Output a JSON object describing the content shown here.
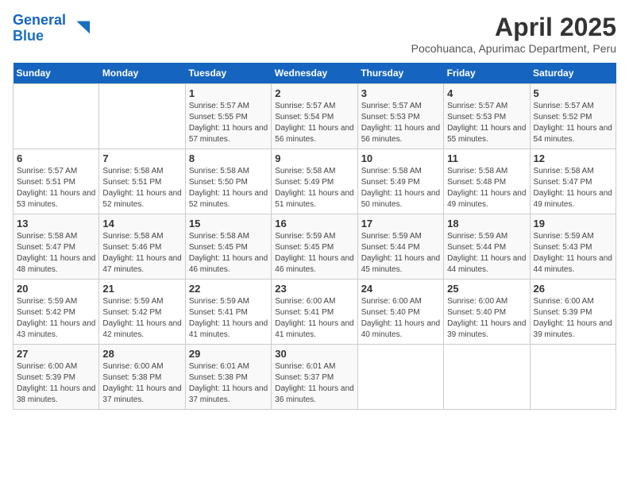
{
  "header": {
    "logo_line1": "General",
    "logo_line2": "Blue",
    "title": "April 2025",
    "subtitle": "Pocohuanca, Apurimac Department, Peru"
  },
  "weekdays": [
    "Sunday",
    "Monday",
    "Tuesday",
    "Wednesday",
    "Thursday",
    "Friday",
    "Saturday"
  ],
  "weeks": [
    [
      {
        "day": "",
        "detail": ""
      },
      {
        "day": "",
        "detail": ""
      },
      {
        "day": "1",
        "detail": "Sunrise: 5:57 AM\nSunset: 5:55 PM\nDaylight: 11 hours and 57 minutes."
      },
      {
        "day": "2",
        "detail": "Sunrise: 5:57 AM\nSunset: 5:54 PM\nDaylight: 11 hours and 56 minutes."
      },
      {
        "day": "3",
        "detail": "Sunrise: 5:57 AM\nSunset: 5:53 PM\nDaylight: 11 hours and 56 minutes."
      },
      {
        "day": "4",
        "detail": "Sunrise: 5:57 AM\nSunset: 5:53 PM\nDaylight: 11 hours and 55 minutes."
      },
      {
        "day": "5",
        "detail": "Sunrise: 5:57 AM\nSunset: 5:52 PM\nDaylight: 11 hours and 54 minutes."
      }
    ],
    [
      {
        "day": "6",
        "detail": "Sunrise: 5:57 AM\nSunset: 5:51 PM\nDaylight: 11 hours and 53 minutes."
      },
      {
        "day": "7",
        "detail": "Sunrise: 5:58 AM\nSunset: 5:51 PM\nDaylight: 11 hours and 52 minutes."
      },
      {
        "day": "8",
        "detail": "Sunrise: 5:58 AM\nSunset: 5:50 PM\nDaylight: 11 hours and 52 minutes."
      },
      {
        "day": "9",
        "detail": "Sunrise: 5:58 AM\nSunset: 5:49 PM\nDaylight: 11 hours and 51 minutes."
      },
      {
        "day": "10",
        "detail": "Sunrise: 5:58 AM\nSunset: 5:49 PM\nDaylight: 11 hours and 50 minutes."
      },
      {
        "day": "11",
        "detail": "Sunrise: 5:58 AM\nSunset: 5:48 PM\nDaylight: 11 hours and 49 minutes."
      },
      {
        "day": "12",
        "detail": "Sunrise: 5:58 AM\nSunset: 5:47 PM\nDaylight: 11 hours and 49 minutes."
      }
    ],
    [
      {
        "day": "13",
        "detail": "Sunrise: 5:58 AM\nSunset: 5:47 PM\nDaylight: 11 hours and 48 minutes."
      },
      {
        "day": "14",
        "detail": "Sunrise: 5:58 AM\nSunset: 5:46 PM\nDaylight: 11 hours and 47 minutes."
      },
      {
        "day": "15",
        "detail": "Sunrise: 5:58 AM\nSunset: 5:45 PM\nDaylight: 11 hours and 46 minutes."
      },
      {
        "day": "16",
        "detail": "Sunrise: 5:59 AM\nSunset: 5:45 PM\nDaylight: 11 hours and 46 minutes."
      },
      {
        "day": "17",
        "detail": "Sunrise: 5:59 AM\nSunset: 5:44 PM\nDaylight: 11 hours and 45 minutes."
      },
      {
        "day": "18",
        "detail": "Sunrise: 5:59 AM\nSunset: 5:44 PM\nDaylight: 11 hours and 44 minutes."
      },
      {
        "day": "19",
        "detail": "Sunrise: 5:59 AM\nSunset: 5:43 PM\nDaylight: 11 hours and 44 minutes."
      }
    ],
    [
      {
        "day": "20",
        "detail": "Sunrise: 5:59 AM\nSunset: 5:42 PM\nDaylight: 11 hours and 43 minutes."
      },
      {
        "day": "21",
        "detail": "Sunrise: 5:59 AM\nSunset: 5:42 PM\nDaylight: 11 hours and 42 minutes."
      },
      {
        "day": "22",
        "detail": "Sunrise: 5:59 AM\nSunset: 5:41 PM\nDaylight: 11 hours and 41 minutes."
      },
      {
        "day": "23",
        "detail": "Sunrise: 6:00 AM\nSunset: 5:41 PM\nDaylight: 11 hours and 41 minutes."
      },
      {
        "day": "24",
        "detail": "Sunrise: 6:00 AM\nSunset: 5:40 PM\nDaylight: 11 hours and 40 minutes."
      },
      {
        "day": "25",
        "detail": "Sunrise: 6:00 AM\nSunset: 5:40 PM\nDaylight: 11 hours and 39 minutes."
      },
      {
        "day": "26",
        "detail": "Sunrise: 6:00 AM\nSunset: 5:39 PM\nDaylight: 11 hours and 39 minutes."
      }
    ],
    [
      {
        "day": "27",
        "detail": "Sunrise: 6:00 AM\nSunset: 5:39 PM\nDaylight: 11 hours and 38 minutes."
      },
      {
        "day": "28",
        "detail": "Sunrise: 6:00 AM\nSunset: 5:38 PM\nDaylight: 11 hours and 37 minutes."
      },
      {
        "day": "29",
        "detail": "Sunrise: 6:01 AM\nSunset: 5:38 PM\nDaylight: 11 hours and 37 minutes."
      },
      {
        "day": "30",
        "detail": "Sunrise: 6:01 AM\nSunset: 5:37 PM\nDaylight: 11 hours and 36 minutes."
      },
      {
        "day": "",
        "detail": ""
      },
      {
        "day": "",
        "detail": ""
      },
      {
        "day": "",
        "detail": ""
      }
    ]
  ]
}
